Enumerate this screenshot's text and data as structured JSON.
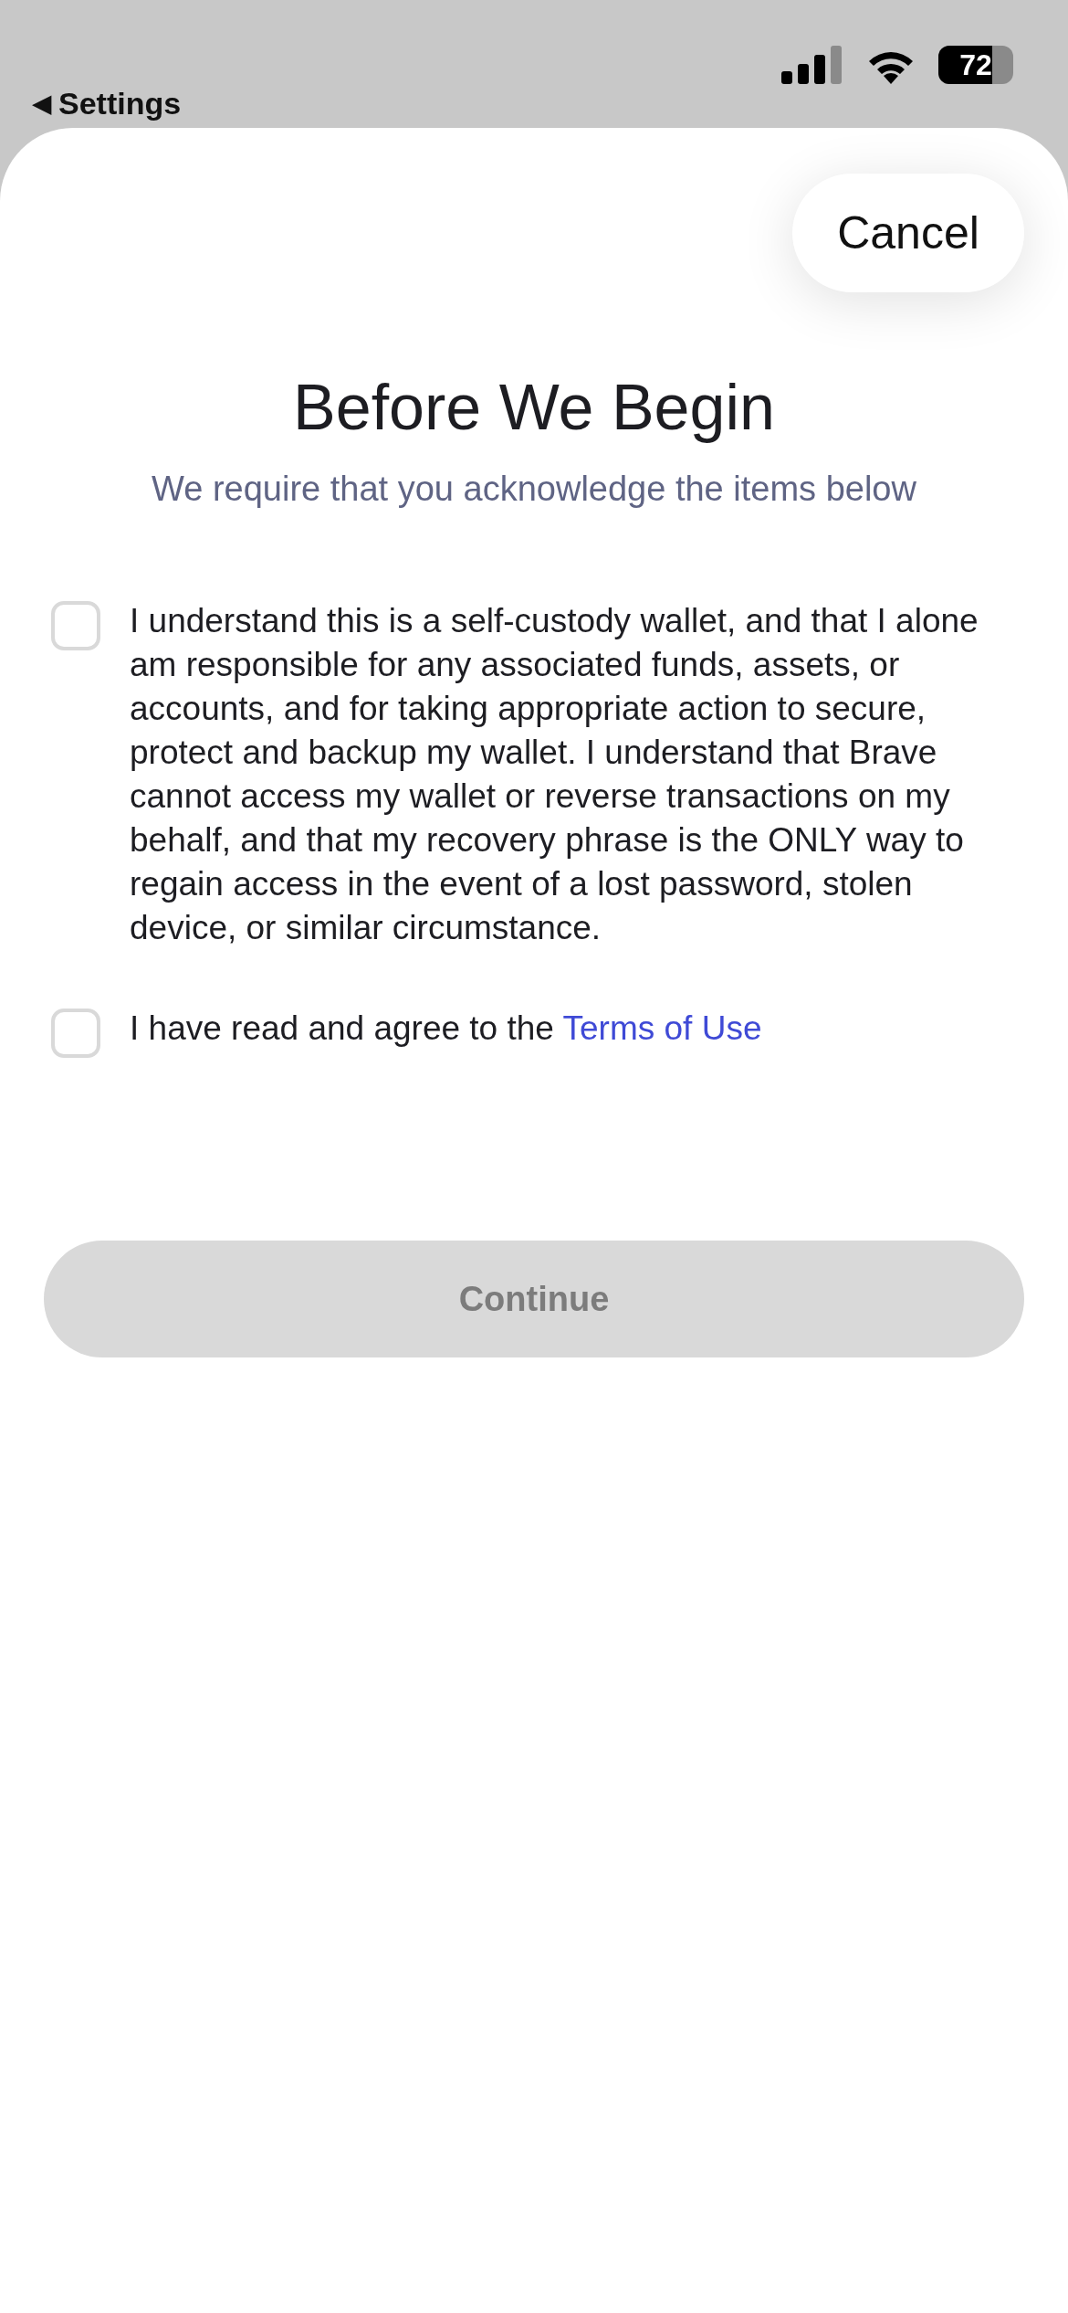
{
  "status_bar": {
    "back_icon": "◀",
    "back_label": "Settings",
    "battery": "72"
  },
  "sheet": {
    "cancel": "Cancel",
    "title": "Before We Begin",
    "subtitle": "We require that you acknowledge the items below",
    "items": [
      {
        "text": "I understand this is a self-custody wallet, and that I alone am responsible for any associated funds, assets, or accounts, and for taking appropriate action to secure, protect and backup my wallet. I understand that Brave cannot access my wallet or reverse transactions on my behalf, and that my recovery phrase is the ONLY way to regain access in the event of a lost password, stolen device, or similar circumstance.",
        "checked": false
      },
      {
        "text": "I have read and agree to the",
        "link": "Terms of Use",
        "checked": false
      }
    ],
    "continue": {
      "label": "Continue",
      "disabled": true
    }
  }
}
